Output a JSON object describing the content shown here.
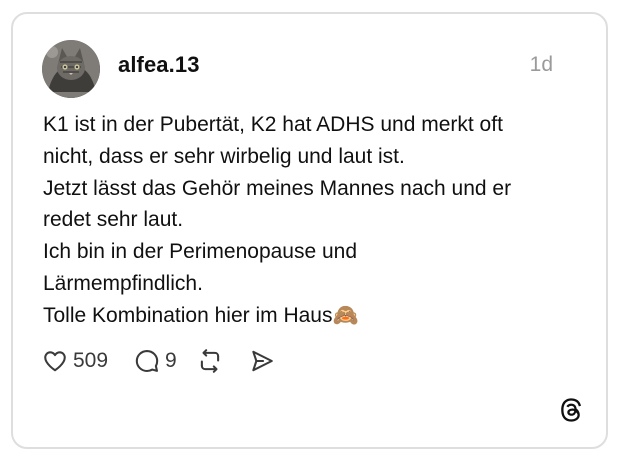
{
  "post": {
    "username": "alfea.13",
    "timestamp": "1d",
    "text_lines": [
      "K1 ist in der Pubertät, K2 hat ADHS und merkt oft",
      "nicht, dass er sehr wirbelig und laut ist.",
      "Jetzt lässt das Gehör meines Mannes nach und er",
      "redet sehr laut.",
      "Ich bin in der Perimenopause und",
      "Lärmempfindlich.",
      "Tolle Kombination hier im Haus🙈"
    ]
  },
  "actions": {
    "likes": "509",
    "replies": "9",
    "icons": [
      "heart-icon",
      "comment-icon",
      "repost-icon",
      "share-icon"
    ]
  },
  "brand": {
    "logo": "threads-logo-icon",
    "border_color": "#dedede",
    "muted_color": "#9a9a9a"
  }
}
